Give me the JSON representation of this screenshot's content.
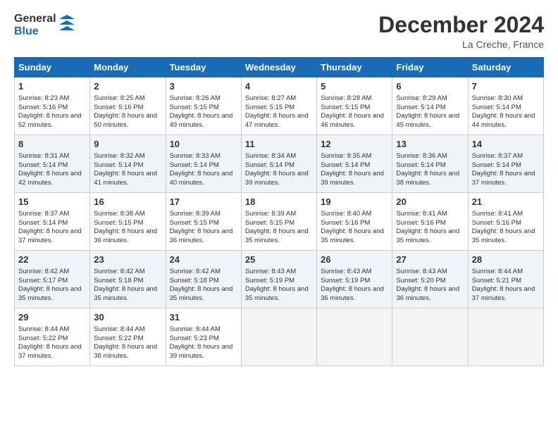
{
  "header": {
    "logo_general": "General",
    "logo_blue": "Blue",
    "month_title": "December 2024",
    "location": "La Creche, France"
  },
  "days_of_week": [
    "Sunday",
    "Monday",
    "Tuesday",
    "Wednesday",
    "Thursday",
    "Friday",
    "Saturday"
  ],
  "weeks": [
    [
      {
        "day": 1,
        "sunrise": "8:23 AM",
        "sunset": "5:16 PM",
        "daylight": "8 hours and 52 minutes."
      },
      {
        "day": 2,
        "sunrise": "8:25 AM",
        "sunset": "5:16 PM",
        "daylight": "8 hours and 50 minutes."
      },
      {
        "day": 3,
        "sunrise": "8:26 AM",
        "sunset": "5:15 PM",
        "daylight": "8 hours and 49 minutes."
      },
      {
        "day": 4,
        "sunrise": "8:27 AM",
        "sunset": "5:15 PM",
        "daylight": "8 hours and 47 minutes."
      },
      {
        "day": 5,
        "sunrise": "8:28 AM",
        "sunset": "5:15 PM",
        "daylight": "8 hours and 46 minutes."
      },
      {
        "day": 6,
        "sunrise": "8:29 AM",
        "sunset": "5:14 PM",
        "daylight": "8 hours and 45 minutes."
      },
      {
        "day": 7,
        "sunrise": "8:30 AM",
        "sunset": "5:14 PM",
        "daylight": "8 hours and 44 minutes."
      }
    ],
    [
      {
        "day": 8,
        "sunrise": "8:31 AM",
        "sunset": "5:14 PM",
        "daylight": "8 hours and 42 minutes."
      },
      {
        "day": 9,
        "sunrise": "8:32 AM",
        "sunset": "5:14 PM",
        "daylight": "8 hours and 41 minutes."
      },
      {
        "day": 10,
        "sunrise": "8:33 AM",
        "sunset": "5:14 PM",
        "daylight": "8 hours and 40 minutes."
      },
      {
        "day": 11,
        "sunrise": "8:34 AM",
        "sunset": "5:14 PM",
        "daylight": "8 hours and 39 minutes."
      },
      {
        "day": 12,
        "sunrise": "8:35 AM",
        "sunset": "5:14 PM",
        "daylight": "8 hours and 39 minutes."
      },
      {
        "day": 13,
        "sunrise": "8:36 AM",
        "sunset": "5:14 PM",
        "daylight": "8 hours and 38 minutes."
      },
      {
        "day": 14,
        "sunrise": "8:37 AM",
        "sunset": "5:14 PM",
        "daylight": "8 hours and 37 minutes."
      }
    ],
    [
      {
        "day": 15,
        "sunrise": "8:37 AM",
        "sunset": "5:14 PM",
        "daylight": "8 hours and 37 minutes."
      },
      {
        "day": 16,
        "sunrise": "8:38 AM",
        "sunset": "5:15 PM",
        "daylight": "8 hours and 36 minutes."
      },
      {
        "day": 17,
        "sunrise": "8:39 AM",
        "sunset": "5:15 PM",
        "daylight": "8 hours and 36 minutes."
      },
      {
        "day": 18,
        "sunrise": "8:39 AM",
        "sunset": "5:15 PM",
        "daylight": "8 hours and 35 minutes."
      },
      {
        "day": 19,
        "sunrise": "8:40 AM",
        "sunset": "5:16 PM",
        "daylight": "8 hours and 35 minutes."
      },
      {
        "day": 20,
        "sunrise": "8:41 AM",
        "sunset": "5:16 PM",
        "daylight": "8 hours and 35 minutes."
      },
      {
        "day": 21,
        "sunrise": "8:41 AM",
        "sunset": "5:16 PM",
        "daylight": "8 hours and 35 minutes."
      }
    ],
    [
      {
        "day": 22,
        "sunrise": "8:42 AM",
        "sunset": "5:17 PM",
        "daylight": "8 hours and 35 minutes."
      },
      {
        "day": 23,
        "sunrise": "8:42 AM",
        "sunset": "5:18 PM",
        "daylight": "8 hours and 35 minutes."
      },
      {
        "day": 24,
        "sunrise": "8:42 AM",
        "sunset": "5:18 PM",
        "daylight": "8 hours and 35 minutes."
      },
      {
        "day": 25,
        "sunrise": "8:43 AM",
        "sunset": "5:19 PM",
        "daylight": "8 hours and 35 minutes."
      },
      {
        "day": 26,
        "sunrise": "8:43 AM",
        "sunset": "5:19 PM",
        "daylight": "8 hours and 36 minutes."
      },
      {
        "day": 27,
        "sunrise": "8:43 AM",
        "sunset": "5:20 PM",
        "daylight": "8 hours and 36 minutes."
      },
      {
        "day": 28,
        "sunrise": "8:44 AM",
        "sunset": "5:21 PM",
        "daylight": "8 hours and 37 minutes."
      }
    ],
    [
      {
        "day": 29,
        "sunrise": "8:44 AM",
        "sunset": "5:22 PM",
        "daylight": "8 hours and 37 minutes."
      },
      {
        "day": 30,
        "sunrise": "8:44 AM",
        "sunset": "5:22 PM",
        "daylight": "8 hours and 38 minutes."
      },
      {
        "day": 31,
        "sunrise": "8:44 AM",
        "sunset": "5:23 PM",
        "daylight": "8 hours and 39 minutes."
      },
      null,
      null,
      null,
      null
    ]
  ],
  "labels": {
    "sunrise": "Sunrise:",
    "sunset": "Sunset:",
    "daylight": "Daylight:"
  }
}
